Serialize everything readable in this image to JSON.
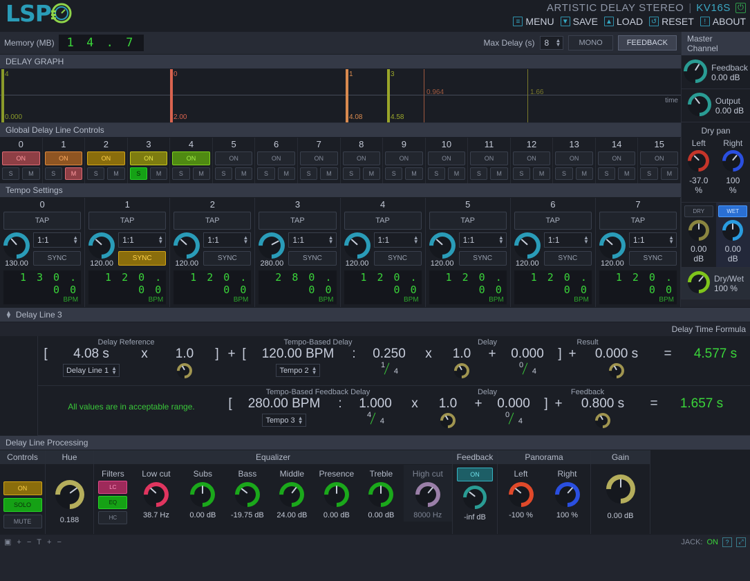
{
  "header": {
    "logo_text": "LSP",
    "logo_icon": "gauge-icon",
    "title": "ARTISTIC DELAY STEREO",
    "separator": "|",
    "model": "KV16S",
    "power_icon": "power-icon",
    "menu": [
      {
        "label": "MENU",
        "icon": "hamburger-icon"
      },
      {
        "label": "SAVE",
        "icon": "download-icon"
      },
      {
        "label": "LOAD",
        "icon": "upload-icon"
      },
      {
        "label": "RESET",
        "icon": "refresh-icon"
      },
      {
        "label": "ABOUT",
        "icon": "info-icon"
      }
    ]
  },
  "memory_bar": {
    "label": "Memory (MB)",
    "value": "1 4 . 7",
    "max_delay_label": "Max Delay (s)",
    "max_delay_value": "8",
    "mono_label": "MONO",
    "feedback_label": "FEEDBACK"
  },
  "delay_graph": {
    "title": "DELAY GRAPH",
    "time_label": "time",
    "markers": [
      {
        "id": "4",
        "top_label": "4",
        "bottom_label": "0.000",
        "color": "#8a9a2a",
        "x_pct": 0.2,
        "thick": true
      },
      {
        "id": "0",
        "top_label": "0",
        "bottom_label": "2.00",
        "color": "#d9634f",
        "x_pct": 25.0,
        "thick": true
      },
      {
        "id": "1",
        "top_label": "1",
        "bottom_label": "4.08",
        "color": "#d98a4f",
        "x_pct": 50.8,
        "thick": true
      },
      {
        "id": "3",
        "top_label": "3",
        "bottom_label": "4.58",
        "color": "#9aa62a",
        "x_pct": 56.9,
        "thick": true
      }
    ],
    "thin_markers": [
      {
        "label": "0.964",
        "color": "#a05a40",
        "x_pct": 62.2
      },
      {
        "label": "1.66",
        "color": "#7b7a2c",
        "x_pct": 77.5
      }
    ]
  },
  "global_delay": {
    "title": "Global Delay Line Controls",
    "on_label": "ON",
    "solo_label": "S",
    "mute_label": "M",
    "lines": [
      {
        "num": "0",
        "on": true,
        "on_color": "#8e3f45",
        "on_border": "#e06b74",
        "on_text": "#ff9aa0",
        "solo": false,
        "mute": false
      },
      {
        "num": "1",
        "on": true,
        "on_color": "#8f5522",
        "on_border": "#e08a3c",
        "on_text": "#ffae63",
        "solo": false,
        "mute": true,
        "mute_color": "#8e3f45",
        "mute_border": "#e06b74",
        "mute_text": "#ff9aa0"
      },
      {
        "num": "2",
        "on": true,
        "on_color": "#8a6d0c",
        "on_border": "#d4a617",
        "on_text": "#ffd24a",
        "solo": false,
        "mute": false
      },
      {
        "num": "3",
        "on": true,
        "on_color": "#7d7c10",
        "on_border": "#c9c81c",
        "on_text": "#e8e74a",
        "solo": true,
        "solo_color": "#15a115",
        "solo_border": "#27d427",
        "solo_text": "#071b07",
        "mute": false
      },
      {
        "num": "4",
        "on": true,
        "on_color": "#4f8a12",
        "on_border": "#7fd41c",
        "on_text": "#a8f24a",
        "solo": false,
        "mute": false
      },
      {
        "num": "5",
        "on": false,
        "solo": false,
        "mute": false
      },
      {
        "num": "6",
        "on": false,
        "solo": false,
        "mute": false
      },
      {
        "num": "7",
        "on": false,
        "solo": false,
        "mute": false
      },
      {
        "num": "8",
        "on": false,
        "solo": false,
        "mute": false
      },
      {
        "num": "9",
        "on": false,
        "solo": false,
        "mute": false
      },
      {
        "num": "10",
        "on": false,
        "solo": false,
        "mute": false
      },
      {
        "num": "11",
        "on": false,
        "solo": false,
        "mute": false
      },
      {
        "num": "12",
        "on": false,
        "solo": false,
        "mute": false
      },
      {
        "num": "13",
        "on": false,
        "solo": false,
        "mute": false
      },
      {
        "num": "14",
        "on": false,
        "solo": false,
        "mute": false
      },
      {
        "num": "15",
        "on": false,
        "solo": false,
        "mute": false
      }
    ]
  },
  "tempo": {
    "title": "Tempo Settings",
    "tap_label": "TAP",
    "sync_label": "SYNC",
    "bpm_label": "BPM",
    "cells": [
      {
        "num": "0",
        "knob_value": "130.00",
        "ratio": "1:1",
        "sync": false,
        "bpm": "1 3 0 . 0 0",
        "angle": -42
      },
      {
        "num": "1",
        "knob_value": "120.00",
        "ratio": "1:1",
        "sync": true,
        "bpm": "1 2 0 . 0 0",
        "angle": -48
      },
      {
        "num": "2",
        "knob_value": "120.00",
        "ratio": "1:1",
        "sync": false,
        "bpm": "1 2 0 . 0 0",
        "angle": -48
      },
      {
        "num": "3",
        "knob_value": "280.00",
        "ratio": "1:1",
        "sync": false,
        "bpm": "2 8 0 . 0 0",
        "angle": 62
      },
      {
        "num": "4",
        "knob_value": "120.00",
        "ratio": "1:1",
        "sync": false,
        "bpm": "1 2 0 . 0 0",
        "angle": -48
      },
      {
        "num": "5",
        "knob_value": "120.00",
        "ratio": "1:1",
        "sync": false,
        "bpm": "1 2 0 . 0 0",
        "angle": -48
      },
      {
        "num": "6",
        "knob_value": "120.00",
        "ratio": "1:1",
        "sync": false,
        "bpm": "1 2 0 . 0 0",
        "angle": -48
      },
      {
        "num": "7",
        "knob_value": "120.00",
        "ratio": "1:1",
        "sync": false,
        "bpm": "1 2 0 . 0 0",
        "angle": -48
      }
    ]
  },
  "master": {
    "title": "Master Channel",
    "feedback": {
      "label": "Feedback",
      "value": "0.00 dB",
      "angle": 32
    },
    "output": {
      "label": "Output",
      "value": "0.00 dB",
      "angle": -38
    },
    "dry_pan": {
      "title": "Dry pan",
      "left_label": "Left",
      "right_label": "Right",
      "left_value": "-37.0",
      "left_unit": "%",
      "left_angle": -46,
      "right_value": "100",
      "right_unit": "%",
      "right_angle": 40
    },
    "dry": {
      "label": "DRY",
      "value": "0.00",
      "unit": "dB",
      "active": false
    },
    "wet": {
      "label": "WET",
      "value": "0.00",
      "unit": "dB",
      "active": true
    },
    "drywet": {
      "label": "Dry/Wet",
      "value": "100 %",
      "angle": 40
    }
  },
  "delay_line": {
    "header": "Delay Line 3",
    "formula_title": "Delay Time Formula",
    "row1": {
      "cap_ref": "Delay Reference",
      "cap_tempo": "Tempo-Based Delay",
      "cap_delay": "Delay",
      "cap_result": "Result",
      "bracket_open": "[",
      "ref_value": "4.08 s",
      "mult_sign": "x",
      "mult_value": "1.0",
      "bracket_close": "]",
      "plus1": "+",
      "bracket_open2": "[",
      "bpm_value": "120.00 BPM",
      "colon": ":",
      "frac_value": "0.250",
      "mult_sign2": "x",
      "mult_value2": "1.0",
      "plus2": "+",
      "add_value": "0.000",
      "bracket_close2": "]",
      "plus3": "+",
      "delay_value": "0.000 s",
      "equals": "=",
      "result": "4.577 s",
      "select_line": "Delay Line 1",
      "select_tempo": "Tempo 2",
      "frac1_num": "1",
      "frac1_den": "4",
      "frac2_num": "0",
      "frac2_den": "4"
    },
    "row2": {
      "cap_tempo": "Tempo-Based Feedback Delay",
      "cap_delay": "Delay",
      "cap_result": "Feedback",
      "status_msg": "All values are in acceptable range.",
      "bracket_open": "[",
      "bpm_value": "280.00 BPM",
      "colon": ":",
      "frac_value": "1.000",
      "mult_sign": "x",
      "mult_value": "1.0",
      "plus": "+",
      "add_value": "0.000",
      "bracket_close": "]",
      "plus2": "+",
      "delay_value": "0.800 s",
      "equals": "=",
      "result": "1.657 s",
      "select_tempo": "Tempo 3",
      "frac1_num": "4",
      "frac1_den": "4",
      "frac2_num": "0",
      "frac2_den": "4"
    }
  },
  "processing": {
    "title": "Delay Line Processing",
    "controls": {
      "caption": "Controls",
      "on": {
        "label": "ON",
        "active": true,
        "bg": "#8a6d0c",
        "border": "#d4a617",
        "text": "#ffd24a"
      },
      "solo": {
        "label": "SOLO",
        "active": true,
        "bg": "#15a115",
        "border": "#27d427",
        "text": "#0b2d0b"
      },
      "mute": {
        "label": "MUTE",
        "active": false
      }
    },
    "hue": {
      "caption": "Hue",
      "value": "0.188",
      "angle": 54,
      "color": "#b5ae5c"
    },
    "equalizer": {
      "caption": "Equalizer",
      "filters_label": "Filters",
      "filter_buttons": [
        {
          "label": "LC",
          "active": true,
          "bg": "#9e2a5a",
          "border": "#e0488a",
          "text": "#ff9ac4"
        },
        {
          "label": "EQ",
          "active": true,
          "bg": "#15a115",
          "border": "#27d427",
          "text": "#0b2d0b"
        },
        {
          "label": "HC",
          "active": false
        }
      ],
      "bands": [
        {
          "label": "Low cut",
          "value": "38.7 Hz",
          "angle": -48,
          "color": "#e0355f",
          "dim": false
        },
        {
          "label": "Subs",
          "value": "0.00 dB",
          "angle": 0,
          "color": "#1ba81b",
          "dim": false
        },
        {
          "label": "Bass",
          "value": "-19.75 dB",
          "angle": -52,
          "color": "#1ba81b",
          "dim": false
        },
        {
          "label": "Middle",
          "value": "24.00 dB",
          "angle": 38,
          "color": "#1ba81b",
          "dim": false
        },
        {
          "label": "Presence",
          "value": "0.00 dB",
          "angle": 0,
          "color": "#1ba81b",
          "dim": false
        },
        {
          "label": "Treble",
          "value": "0.00 dB",
          "angle": 0,
          "color": "#1ba81b",
          "dim": false
        },
        {
          "label": "High cut",
          "value": "8000 Hz",
          "angle": 40,
          "color": "#9a7fa8",
          "dim": true
        }
      ]
    },
    "feedback": {
      "caption": "Feedback",
      "on": {
        "label": "ON",
        "active": true,
        "bg": "#1d5e66",
        "border": "#36b5c4",
        "text": "#6fe0ea"
      },
      "value": "-inf dB",
      "angle": -52,
      "color": "#2a9c94"
    },
    "panorama": {
      "caption": "Panorama",
      "left_label": "Left",
      "right_label": "Right",
      "left_value": "-100 %",
      "left_angle": -50,
      "left_color": "#e0492a",
      "right_value": "100 %",
      "right_angle": 42,
      "right_color": "#2a4fe0"
    },
    "gain": {
      "caption": "Gain",
      "value": "0.00 dB",
      "angle": 0,
      "color": "#b5ae5c"
    }
  },
  "status_bar": {
    "icons": [
      "window-icon",
      "plus-icon",
      "minus-icon",
      "text-icon",
      "plus-icon",
      "minus-icon"
    ],
    "jack_label": "JACK:",
    "jack_state": "ON",
    "help_icon": "question-icon",
    "resize_icon": "resize-icon"
  }
}
